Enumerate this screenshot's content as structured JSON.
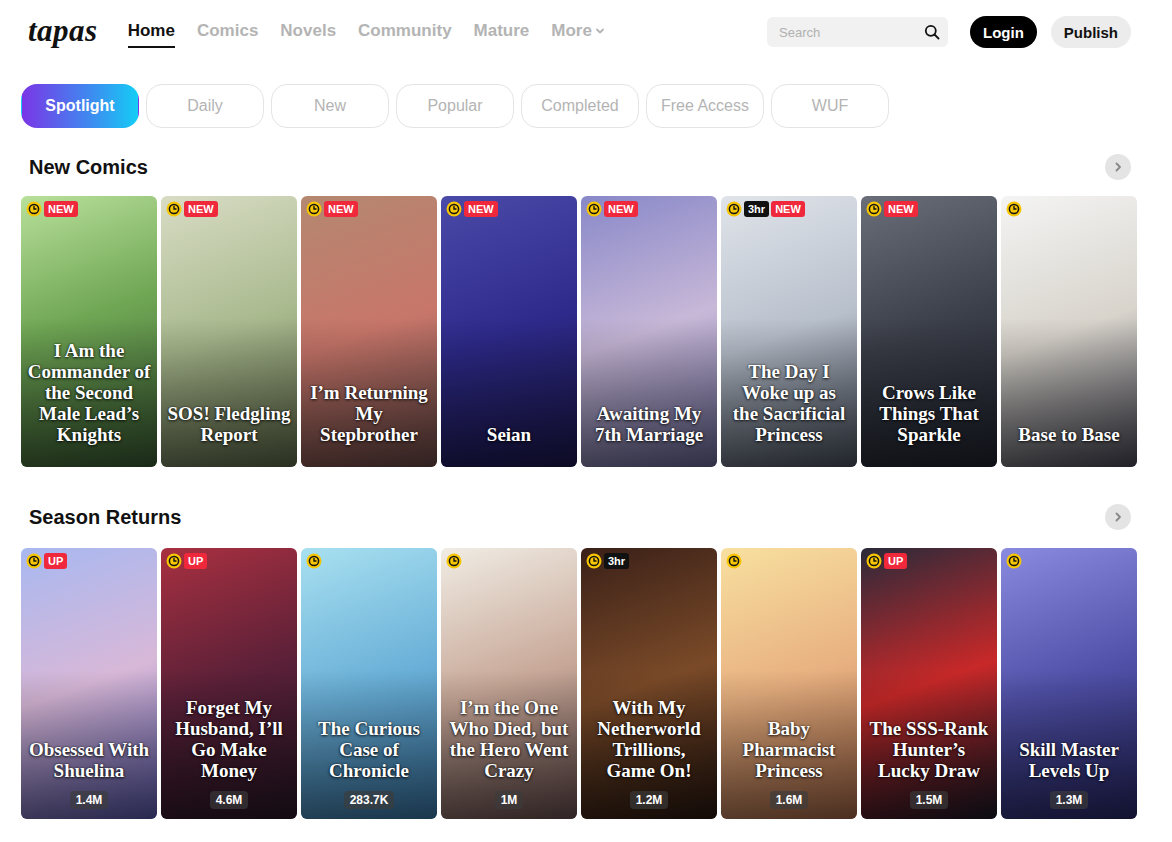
{
  "logo": "tapas",
  "nav": [
    {
      "label": "Home",
      "selected": true
    },
    {
      "label": "Comics",
      "selected": false
    },
    {
      "label": "Novels",
      "selected": false
    },
    {
      "label": "Community",
      "selected": false
    },
    {
      "label": "Mature",
      "selected": false
    },
    {
      "label": "More",
      "selected": false
    }
  ],
  "search": {
    "placeholder": "Search"
  },
  "buttons": {
    "login": "Login",
    "publish": "Publish"
  },
  "tabs": [
    {
      "label": "Spotlight",
      "selected": true
    },
    {
      "label": "Daily",
      "selected": false
    },
    {
      "label": "New",
      "selected": false
    },
    {
      "label": "Popular",
      "selected": false
    },
    {
      "label": "Completed",
      "selected": false
    },
    {
      "label": "Free Access",
      "selected": false
    },
    {
      "label": "WUF",
      "selected": false
    }
  ],
  "sections": [
    {
      "title": "New Comics",
      "cards": [
        {
          "title": "I Am the Commander of the Second Male Lead’s Knights",
          "badges": [
            {
              "text": "NEW",
              "kind": "new"
            }
          ]
        },
        {
          "title": "SOS! Fledgling Report",
          "badges": [
            {
              "text": "NEW",
              "kind": "new"
            }
          ]
        },
        {
          "title": "I’m Returning My Stepbrother",
          "badges": [
            {
              "text": "NEW",
              "kind": "new"
            }
          ]
        },
        {
          "title": "Seian",
          "badges": [
            {
              "text": "NEW",
              "kind": "new"
            }
          ]
        },
        {
          "title": "Awaiting My 7th Marriage",
          "badges": [
            {
              "text": "NEW",
              "kind": "new"
            }
          ]
        },
        {
          "title": "The Day I Woke up as the Sacrificial Princess",
          "badges": [
            {
              "text": "3hr",
              "kind": "time"
            },
            {
              "text": "NEW",
              "kind": "new"
            }
          ]
        },
        {
          "title": "Crows Like Things That Sparkle",
          "badges": [
            {
              "text": "NEW",
              "kind": "new"
            }
          ]
        },
        {
          "title": "Base to Base",
          "badges": []
        }
      ]
    },
    {
      "title": "Season Returns",
      "cards": [
        {
          "title": "Obsessed With Shuelina",
          "views": "1.4M",
          "badges": [
            {
              "text": "UP",
              "kind": "new"
            }
          ]
        },
        {
          "title": "Forget My Husband, I’ll Go Make Money",
          "views": "4.6M",
          "badges": [
            {
              "text": "UP",
              "kind": "new"
            }
          ]
        },
        {
          "title": "The Curious Case of Chronicle",
          "views": "283.7K",
          "badges": []
        },
        {
          "title": "I’m the One Who Died, but the Hero Went Crazy",
          "views": "1M",
          "badges": []
        },
        {
          "title": "With My Netherworld Trillions, Game On!",
          "views": "1.2M",
          "badges": [
            {
              "text": "3hr",
              "kind": "time"
            }
          ]
        },
        {
          "title": "Baby Pharmacist Princess",
          "views": "1.6M",
          "badges": []
        },
        {
          "title": "The SSS-Rank Hunter’s Lucky Draw",
          "views": "1.5M",
          "badges": [
            {
              "text": "UP",
              "kind": "new"
            }
          ]
        },
        {
          "title": "Skill Master Levels Up",
          "views": "1.3M",
          "badges": []
        }
      ]
    }
  ]
}
